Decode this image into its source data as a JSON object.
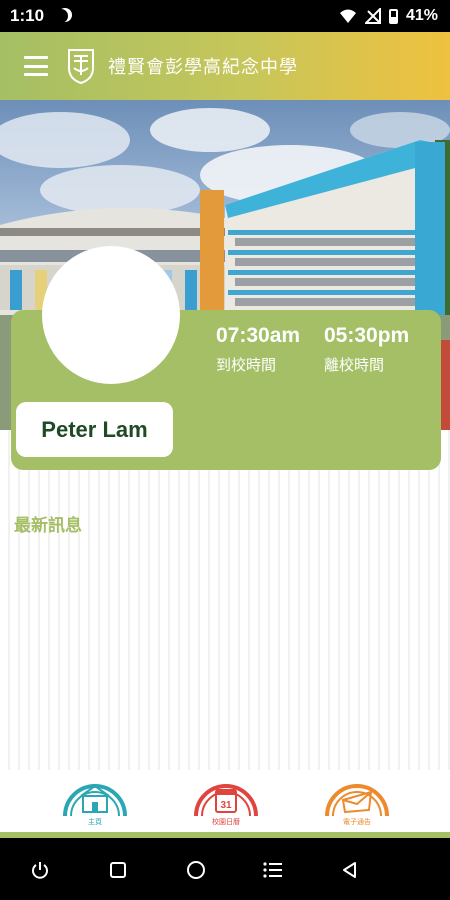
{
  "status_bar": {
    "time": "1:10",
    "battery": "41%"
  },
  "app_bar": {
    "title": "禮賢會彭學高紀念中學"
  },
  "profile": {
    "name": "Peter Lam",
    "arrival_time": "07:30am",
    "arrival_label": "到校時間",
    "departure_time": "05:30pm",
    "departure_label": "離校時間"
  },
  "news": {
    "title": "最新訊息"
  },
  "bottom_nav": {
    "items": [
      {
        "label": "主頁",
        "color": "#2aa7b2",
        "icon": "school-house-icon"
      },
      {
        "label": "校園日曆",
        "color": "#e0443f",
        "icon": "calendar-icon",
        "calendar_day": "31"
      },
      {
        "label": "電子通告",
        "color": "#ee8a2e",
        "icon": "envelope-icon"
      }
    ]
  },
  "colors": {
    "accent": "#a5bf66",
    "gradient_end": "#efc13f",
    "name_text": "#1f4a26"
  }
}
